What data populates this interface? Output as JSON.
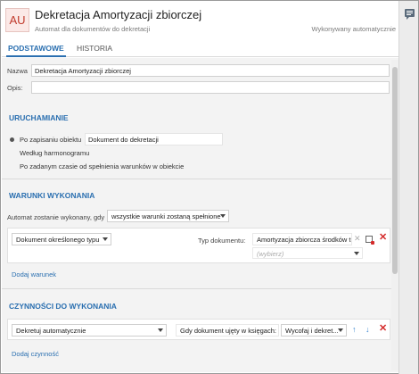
{
  "header": {
    "badge": "AU",
    "title": "Dekretacja Amortyzacji zbiorczej",
    "subtitle": "Automat dla dokumentów do dekretacji",
    "auto_note": "Wykonywany automatycznie"
  },
  "tabs": [
    {
      "label": "PODSTAWOWE",
      "active": true
    },
    {
      "label": "HISTORIA",
      "active": false
    }
  ],
  "form": {
    "name_label": "Nazwa",
    "name_value": "Dekretacja Amortyzacji zbiorczej",
    "desc_label": "Opis:",
    "desc_value": ""
  },
  "run": {
    "section_title": "URUCHAMIANIE",
    "options": [
      {
        "label": "Po zapisaniu obiektu",
        "selected": true,
        "value": "Dokument do dekretacji"
      },
      {
        "label": "Według harmonogramu",
        "selected": false
      },
      {
        "label": "Po zadanym czasie od spełnienia warunków w obiekcie",
        "selected": false
      }
    ]
  },
  "conditions": {
    "section_title": "WARUNKI WYKONANIA",
    "rule_label": "Automat zostanie wykonany, gdy",
    "rule_select": "wszystkie warunki zostaną spełnione",
    "row": {
      "left_select": "Dokument określonego typu",
      "type_label": "Typ dokumentu:",
      "type_value": "Amortyzacja zbiorcza środków tr",
      "placeholder": "(wybierz)"
    },
    "add_link": "Dodaj warunek"
  },
  "actions": {
    "section_title": "CZYNNOŚCI DO WYKONANIA",
    "row": {
      "action_select": "Dekretuj automatycznie",
      "when_label": "Gdy dokument ujęty w księgach:",
      "when_select": "Wycofaj i dekret..."
    },
    "add_link": "Dodaj czynność"
  },
  "colors": {
    "accent": "#2a6fb0",
    "delete": "#d42a2a",
    "badge_text": "#c0392b"
  }
}
